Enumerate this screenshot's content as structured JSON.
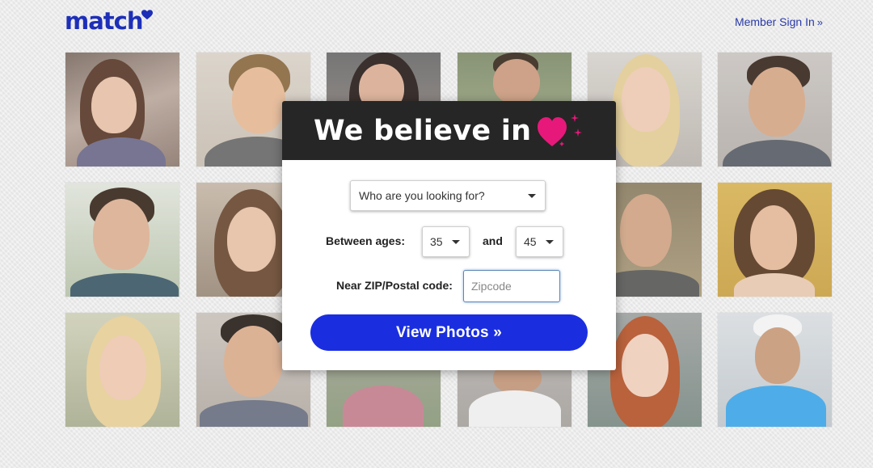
{
  "brand": {
    "logo_text": "match",
    "accent": "#1d2fb8",
    "heart_color": "#e6197a"
  },
  "header": {
    "signin_label": "Member Sign In",
    "signin_suffix": "»"
  },
  "photo_grid": {
    "rows": 3,
    "columns": 6,
    "hidden_behind_modal": true
  },
  "modal": {
    "tagline": "We believe in",
    "tagline_icon": "heart-icon",
    "looking_for": {
      "selected": "Who are you looking for?"
    },
    "age": {
      "label": "Between ages:",
      "min": "35",
      "joiner": "and",
      "max": "45"
    },
    "zip": {
      "label": "Near ZIP/Postal code:",
      "placeholder": "Zipcode",
      "value": ""
    },
    "cta_label": "View Photos »",
    "cta_color": "#1a2ee0"
  }
}
